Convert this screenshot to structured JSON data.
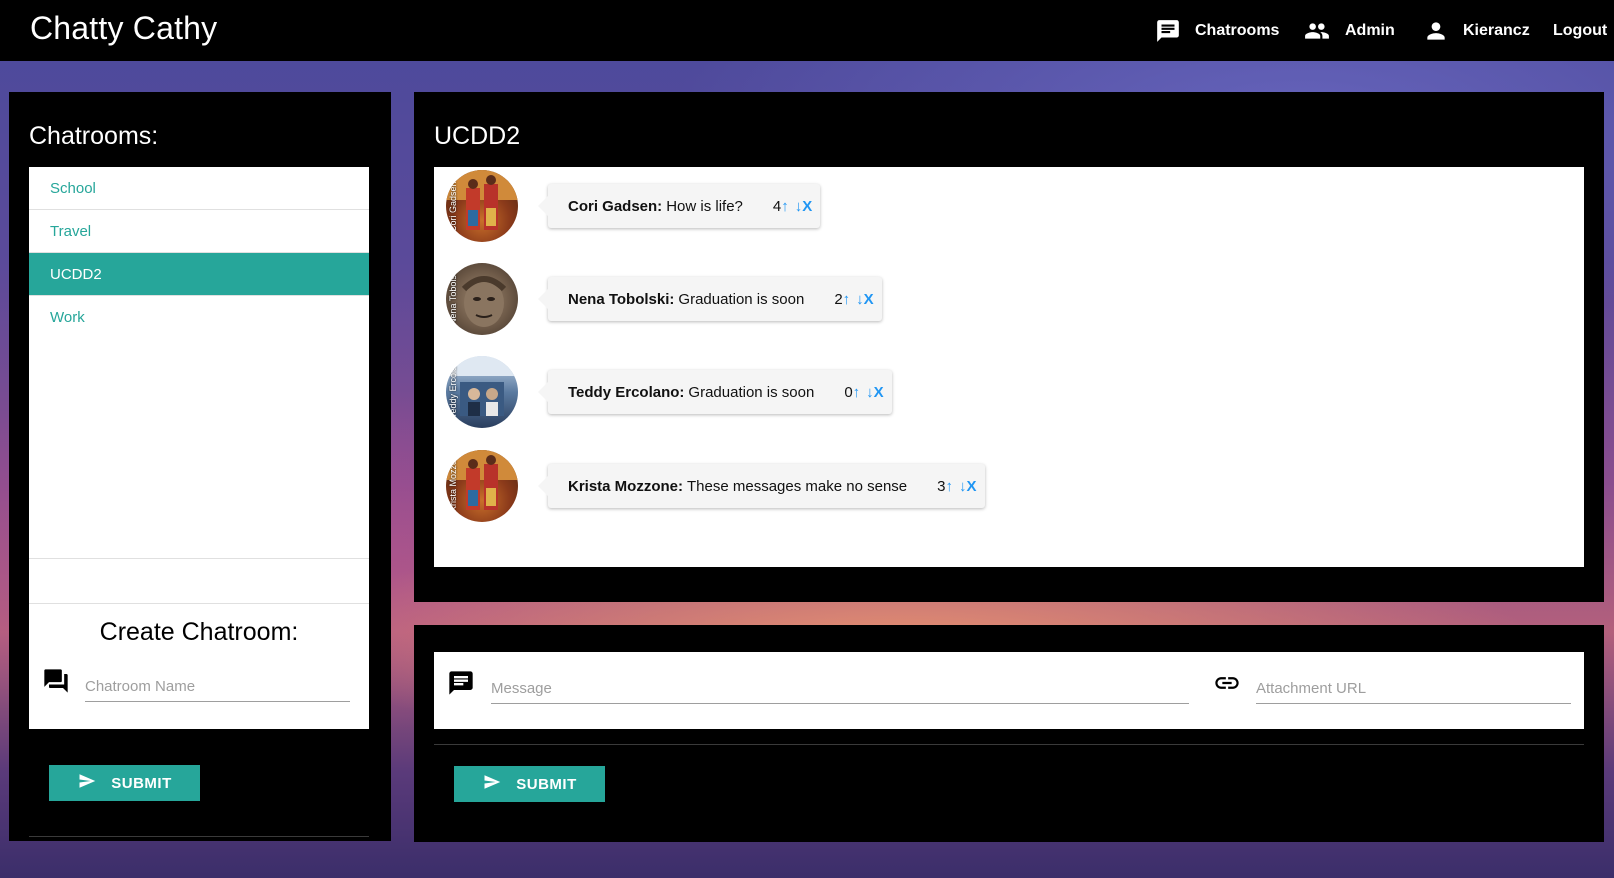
{
  "app": {
    "title": "Chatty Cathy"
  },
  "nav": {
    "chatrooms": "Chatrooms",
    "admin": "Admin",
    "user": "Kierancz",
    "logout": "Logout"
  },
  "sidebar": {
    "heading": "Chatrooms:",
    "rooms": [
      {
        "label": "School",
        "active": false
      },
      {
        "label": "Travel",
        "active": false
      },
      {
        "label": "UCDD2",
        "active": true
      },
      {
        "label": "Work",
        "active": false
      }
    ],
    "create_title": "Create Chatroom:",
    "name_placeholder": "Chatroom Name",
    "submit_label": "SUBMIT"
  },
  "room": {
    "title": "UCDD2",
    "messages": [
      {
        "author": "Cori Gadsen:",
        "text": "How is life?",
        "score": "4",
        "up": "↑",
        "down": "↓",
        "delete": "X",
        "avatar_label": "Cori Gadsen"
      },
      {
        "author": "Nena Tobolski:",
        "text": "Graduation is soon",
        "score": "2",
        "up": "↑",
        "down": "↓",
        "delete": "X",
        "avatar_label": "Nena Tobolski"
      },
      {
        "author": "Teddy Ercolano:",
        "text": "Graduation is soon",
        "score": "0",
        "up": "↑",
        "down": "↓",
        "delete": "X",
        "avatar_label": "Teddy Ercolano"
      },
      {
        "author": "Krista Mozzone:",
        "text": "These messages make no sense",
        "score": "3",
        "up": "↑",
        "down": "↓",
        "delete": "X",
        "avatar_label": "Krista Mozzone"
      }
    ]
  },
  "compose": {
    "message_placeholder": "Message",
    "attachment_placeholder": "Attachment URL",
    "submit_label": "SUBMIT"
  },
  "colors": {
    "accent": "#26a69a",
    "vote": "#2196f3",
    "topbar": "#000000"
  },
  "icons": {
    "chatrooms": "chat-bubble-icon",
    "admin": "people-icon",
    "user": "person-icon",
    "create": "forum-icon",
    "message": "chat-bubble-icon",
    "attachment": "link-icon",
    "submit": "send-icon"
  }
}
